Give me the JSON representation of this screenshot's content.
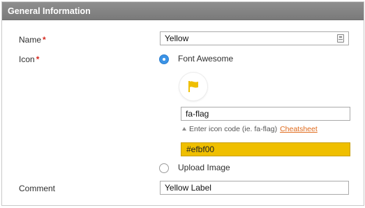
{
  "header": {
    "title": "General Information"
  },
  "fields": {
    "name": {
      "label": "Name",
      "required_mark": "*",
      "value": "Yellow"
    },
    "icon": {
      "label": "Icon",
      "required_mark": "*",
      "options": [
        {
          "label": "Font Awesome",
          "selected": true
        },
        {
          "label": "Upload Image",
          "selected": false
        }
      ],
      "preview_icon": "flag-icon",
      "icon_code": "fa-flag",
      "hint_text": "Enter icon code (ie. fa-flag)",
      "hint_link": "Cheatsheet",
      "color_value": "#efbf00"
    },
    "comment": {
      "label": "Comment",
      "value": "Yellow Label"
    }
  },
  "colors": {
    "accent": "#efbf00",
    "radio_selected": "#3b93e6",
    "header_bg": "#808080",
    "link": "#e06a1b",
    "required": "#d6281e"
  }
}
